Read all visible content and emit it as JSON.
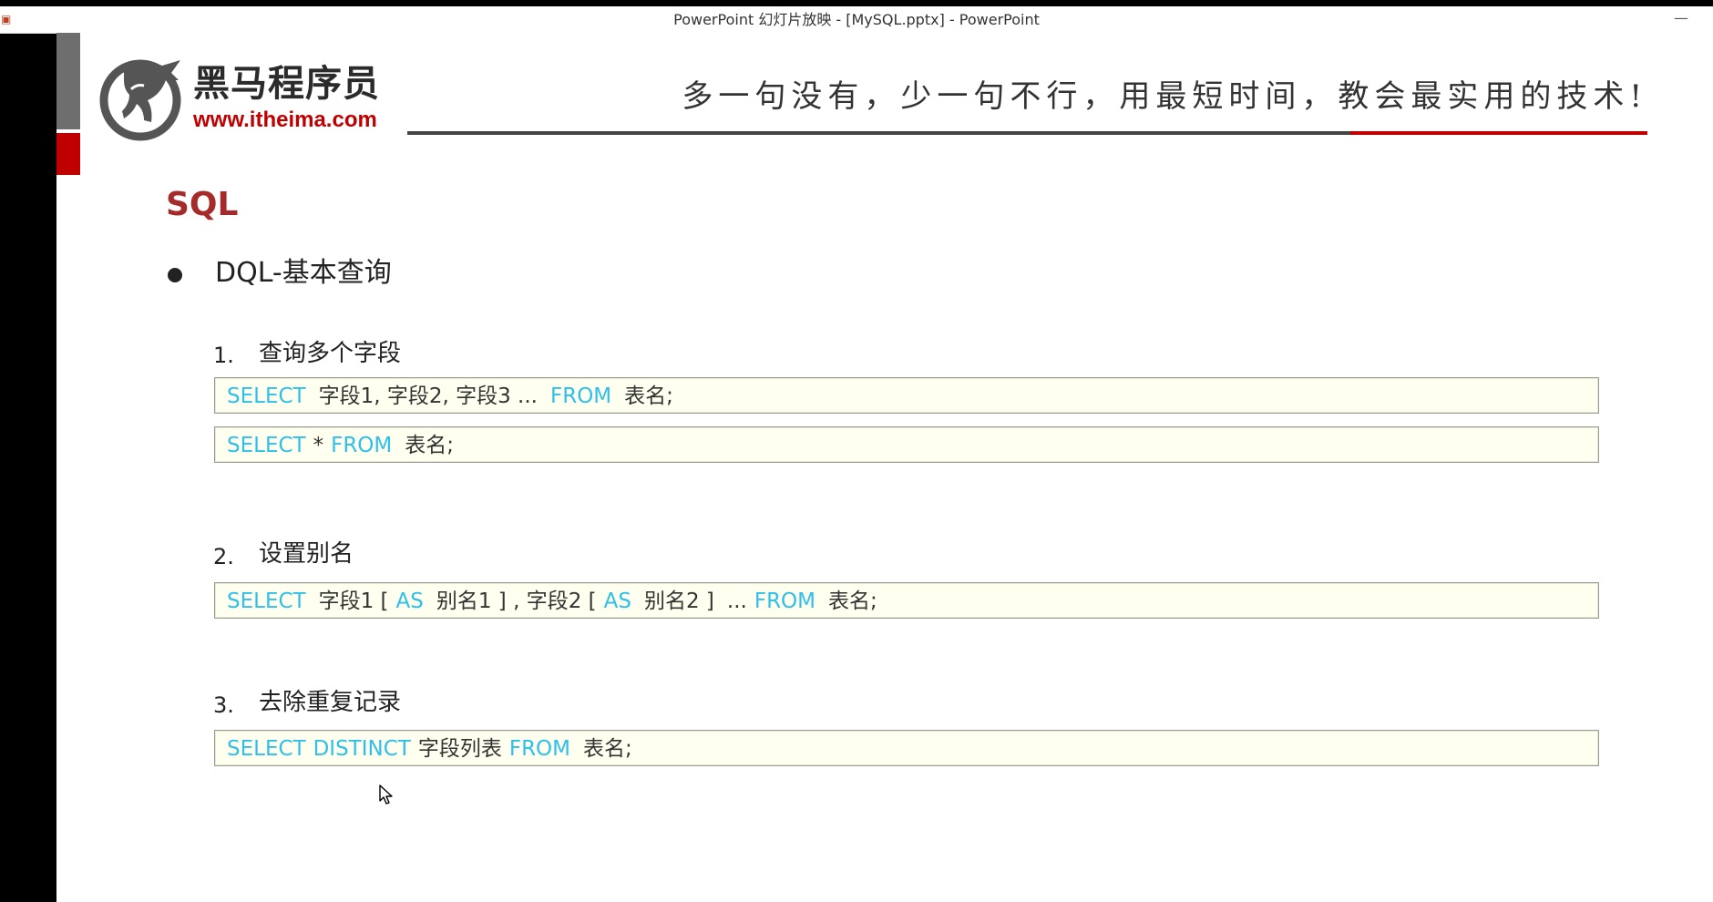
{
  "window": {
    "title": "PowerPoint 幻灯片放映 - [MySQL.pptx] - PowerPoint",
    "minimize_label": "—",
    "app_icon": "ppt-icon"
  },
  "logo": {
    "name": "黑马程序员",
    "url": "www.itheima.com"
  },
  "slogan": "多一句没有，少一句不行，用最短时间，教会最实用的技术!",
  "colors": {
    "accent_red": "#c00000",
    "keyword_cyan": "#2ec0e8",
    "code_bg": "#fffff0",
    "heading": "#a52a2a"
  },
  "slide": {
    "heading": "SQL",
    "section": "DQL-基本查询",
    "items": [
      {
        "num": "1.",
        "title": "查询多个字段",
        "codes": [
          {
            "parts": [
              "SELECT",
              "字段1, 字段2, 字段3 ...",
              "FROM",
              "表名;"
            ]
          },
          {
            "parts": [
              "SELECT",
              "*",
              "FROM",
              "表名;"
            ]
          }
        ]
      },
      {
        "num": "2.",
        "title": "设置别名",
        "codes": [
          {
            "parts": [
              "SELECT",
              "字段1 [",
              "AS",
              "别名1 ] , 字段2 [",
              "AS",
              "别名2 ]",
              "...",
              "FROM",
              "表名;"
            ]
          }
        ]
      },
      {
        "num": "3.",
        "title": "去除重复记录",
        "codes": [
          {
            "parts": [
              "SELECT",
              "DISTINCT",
              "字段列表",
              "FROM",
              "表名;"
            ]
          }
        ]
      }
    ]
  }
}
